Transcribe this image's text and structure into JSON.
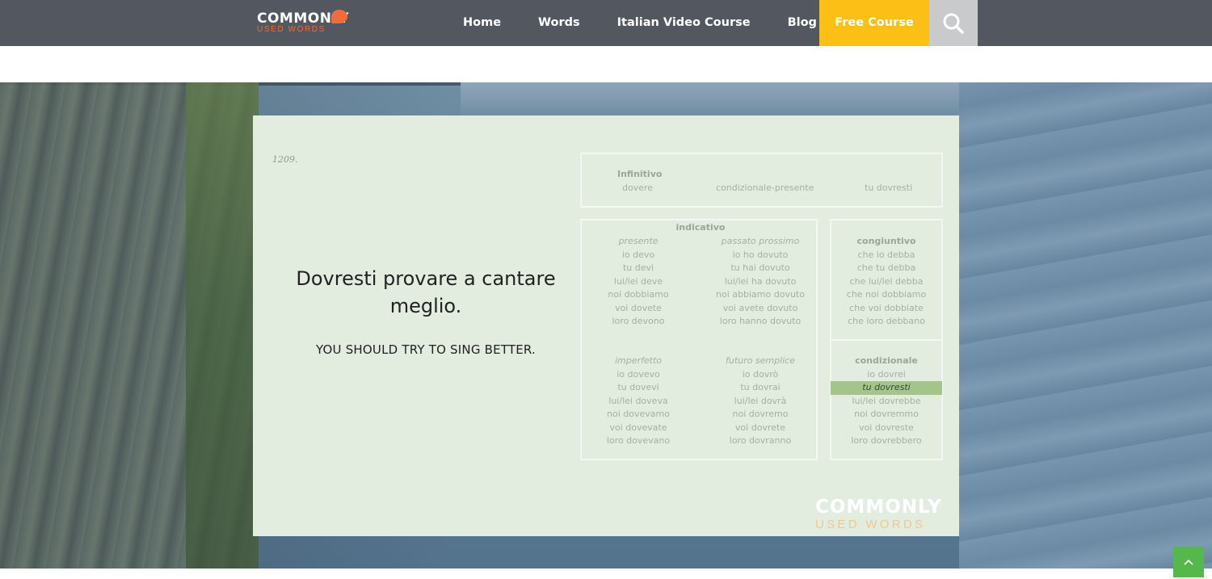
{
  "nav": {
    "logo_top": "COMMONLY",
    "logo_bottom": "USED WORDS",
    "links": [
      "Home",
      "Words",
      "Italian Video Course",
      "Blog"
    ],
    "free_course": "Free Course",
    "search_icon": "search-icon"
  },
  "card": {
    "number": "1209.",
    "sentence_it": "Dovresti provare a cantare meglio.",
    "sentence_en": "YOU SHOULD TRY TO SING BETTER.",
    "infinitive": {
      "label": "Infinitivo",
      "value": "dovere",
      "mood": "condizionale-presente",
      "form": "tu dovresti"
    },
    "indicativo": {
      "title": "indicativo",
      "presente": {
        "heading": "presente",
        "forms": [
          "io devo",
          "tu devi",
          "lui/lei deve",
          "noi dobbiamo",
          "voi dovete",
          "loro devono"
        ]
      },
      "passato_prossimo": {
        "heading": "passato prossimo",
        "forms": [
          "io ho dovuto",
          "tu hai dovuto",
          "lui/lei ha dovuto",
          "noi abbiamo dovuto",
          "voi avete dovuto",
          "loro hanno dovuto"
        ]
      },
      "imperfetto": {
        "heading": "imperfetto",
        "forms": [
          "io dovevo",
          "tu dovevi",
          "lui/lei doveva",
          "noi dovevamo",
          "voi dovevate",
          "loro dovevano"
        ]
      },
      "futuro_semplice": {
        "heading": "futuro semplice",
        "forms": [
          "io dovrò",
          "tu dovrai",
          "lui/lei dovrà",
          "noi dovremo",
          "voi dovrete",
          "loro dovranno"
        ]
      }
    },
    "congiuntivo": {
      "heading": "congiuntivo",
      "forms": [
        "che io debba",
        "che tu debba",
        "che lui/lei debba",
        "che noi dobbiamo",
        "che voi dobbiate",
        "che loro debbano"
      ]
    },
    "condizionale": {
      "heading": "condizionale",
      "forms": [
        "io dovrei",
        "tu dovresti",
        "lui/lei dovrebbe",
        "noi dovremmo",
        "voi dovreste",
        "loro dovrebbero"
      ],
      "highlight_index": 1
    },
    "watermark_top": "COMMONLY",
    "watermark_bottom": "USED WORDS"
  },
  "colors": {
    "nav_bg": "#53575f",
    "free_course_bg": "#fcbf16",
    "search_bg": "#c9cacc",
    "card_bg": "#e2ecdf",
    "highlight": "#a4c58a",
    "back_to_top": "#54b84b",
    "logo_accent": "#f26b3a"
  },
  "back_to_top_icon": "chevron-up-icon"
}
